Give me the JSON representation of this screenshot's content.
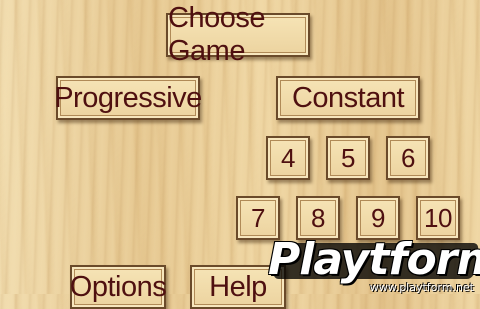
{
  "menu": {
    "title": "Choose Game",
    "modes": [
      {
        "label": "Progressive"
      },
      {
        "label": "Constant"
      }
    ],
    "numbers": [
      "4",
      "5",
      "6",
      "7",
      "8",
      "9",
      "10"
    ],
    "bottom_buttons": [
      {
        "label": "Options"
      },
      {
        "label": "Help"
      }
    ]
  },
  "watermark": {
    "logo_text": "Playtform",
    "url": "www.playtform.net"
  },
  "colors": {
    "text": "#4f1010",
    "tile_border": "#6a4a2a",
    "wood": "#e9cf98"
  }
}
